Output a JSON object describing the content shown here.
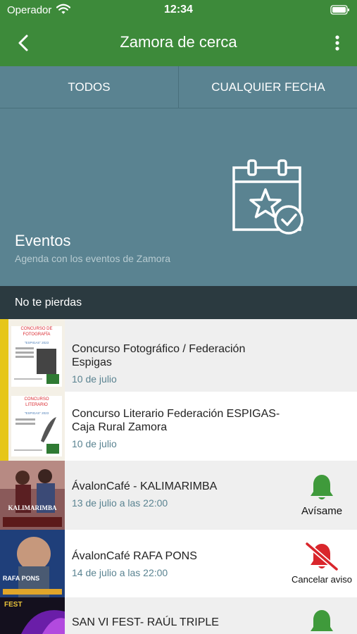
{
  "status_bar": {
    "carrier": "Operador",
    "time": "12:34"
  },
  "nav": {
    "title": "Zamora de cerca"
  },
  "filters": {
    "all": "TODOS",
    "date": "CUALQUIER FECHA"
  },
  "hero": {
    "title": "Eventos",
    "subtitle": "Agenda con los eventos de Zamora"
  },
  "section": {
    "title": "No te pierdas"
  },
  "thumb_labels": {
    "t1_line1": "CONCURSO DE",
    "t1_line2": "FOTOGRAFÍA",
    "t1_tag": "\"ESPIGAS\" 2023",
    "t2_line1": "CONCURSO",
    "t2_line2": "LITERARIO",
    "t2_tag": "\"ESPIGAS\" 2023",
    "t3_band": "KALIMARIMBA",
    "t4_name": "RAFA PONS",
    "t5_fest": "FEST"
  },
  "events": [
    {
      "title": "Concurso Fotográfico / Federación Espigas",
      "date": "10 de julio"
    },
    {
      "title": "Concurso Literario Federación ESPIGAS-Caja Rural Zamora",
      "date": "10 de julio"
    },
    {
      "title": "ÁvalonCafé - KALIMARIMBA",
      "date": "13 de julio a las 22:00",
      "action": "Avísame"
    },
    {
      "title": "ÁvalonCafé RAFA PONS",
      "date": "14 de julio a las 22:00",
      "action": "Cancelar aviso"
    },
    {
      "title": "SAN VI FEST- RAÚL TRIPLE",
      "date": ""
    }
  ],
  "colors": {
    "nav_green": "#3d8a3a",
    "filter_teal": "#5a8391",
    "section_dark": "#2b3a40",
    "date_teal": "#5a8391",
    "bell_green": "#3f9a3b",
    "bell_red": "#d9262c"
  },
  "icons": {
    "back": "chevron-left-icon",
    "more": "more-vertical-icon",
    "hero": "calendar-star-check-icon",
    "notify": "bell-icon",
    "cancel": "bell-slash-icon"
  }
}
